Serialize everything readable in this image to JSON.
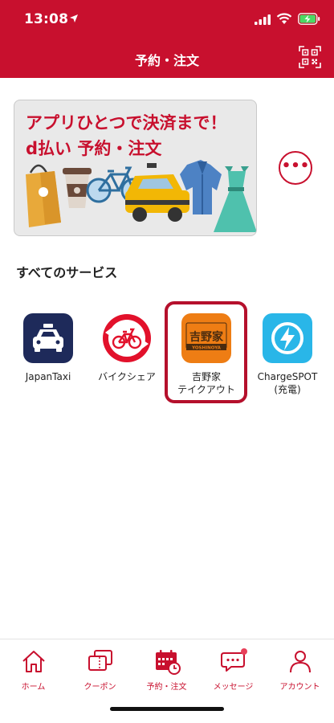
{
  "status_bar": {
    "time": "13:08"
  },
  "header": {
    "title": "予約・注文",
    "qr_icon": "qr-scan-icon",
    "color": "#c8102e"
  },
  "banner": {
    "line1": "アプリひとつで決済まで！",
    "line2": "d払い 予約・注文"
  },
  "more_button": {
    "label": "•••"
  },
  "services_section": {
    "title": "すべてのサービス",
    "items": [
      {
        "label": "JapanTaxi",
        "icon": "taxi-icon"
      },
      {
        "label": "バイクシェア",
        "icon": "bike-share-icon"
      },
      {
        "label": "吉野家\nテイクアウト",
        "icon": "yoshinoya-logo",
        "logo_text": "吉野家",
        "logo_subtext": "YOSHINOYA"
      },
      {
        "label": "ChargeSPOT\n(充電)",
        "icon": "charge-spot-icon"
      }
    ]
  },
  "bottom_nav": {
    "tabs": [
      {
        "label": "ホーム",
        "icon": "home-icon"
      },
      {
        "label": "クーポン",
        "icon": "coupon-icon"
      },
      {
        "label": "予約・注文",
        "icon": "calendar-order-icon"
      },
      {
        "label": "メッセージ",
        "icon": "message-icon"
      },
      {
        "label": "アカウント",
        "icon": "account-icon"
      }
    ]
  }
}
